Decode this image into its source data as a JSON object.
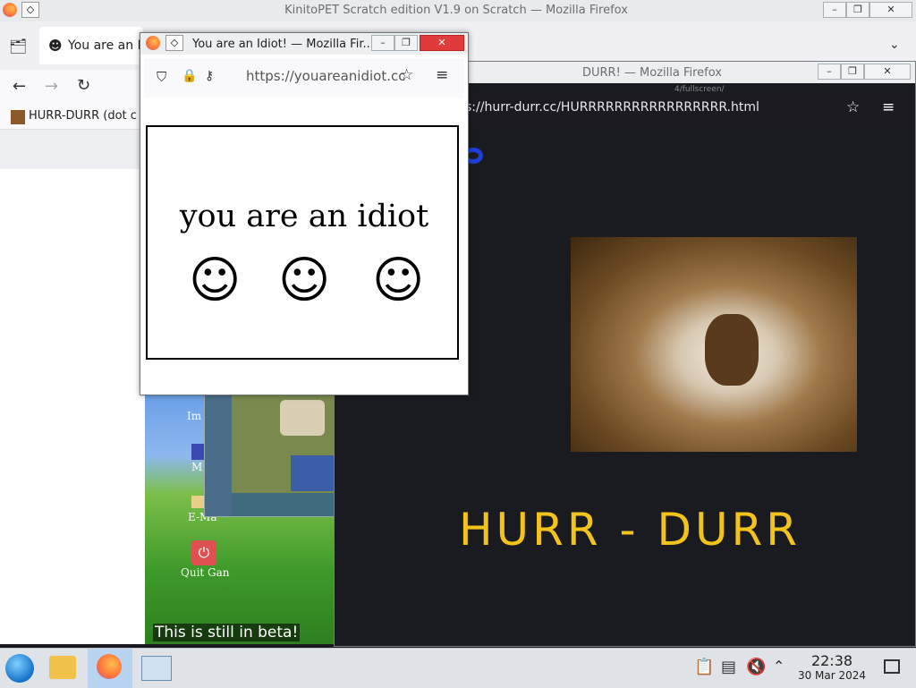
{
  "main_window": {
    "title": "KinitoPET Scratch edition V1.9 on Scratch — Mozilla Firefox",
    "tab_title": "You are an I",
    "bookmark_label": "HURR-DURR (dot c"
  },
  "durr_window": {
    "title": "DURR! — Mozilla Firefox",
    "url": "s://hurr-durr.cc/HURRRRRRRRRRRRRRRRR.html",
    "partial_url": "4/fullscreen/",
    "heading": "HURR - DURR"
  },
  "idiot_window": {
    "title": "You are an Idiot! — Mozilla Fir...",
    "url": "https://youareanidiot.cc",
    "message": "you are an idiot",
    "smiley": "☺"
  },
  "desktop": {
    "icon_labels": [
      "Im",
      "M",
      "E-Ma",
      "Quit Gan"
    ],
    "subtitle": "This is still in beta!"
  },
  "taskbar": {
    "time": "22:38",
    "date": "30 Mar 2024"
  },
  "colors": {
    "hurr_text": "#f2c31b",
    "durr_background": "#1a1b20"
  }
}
